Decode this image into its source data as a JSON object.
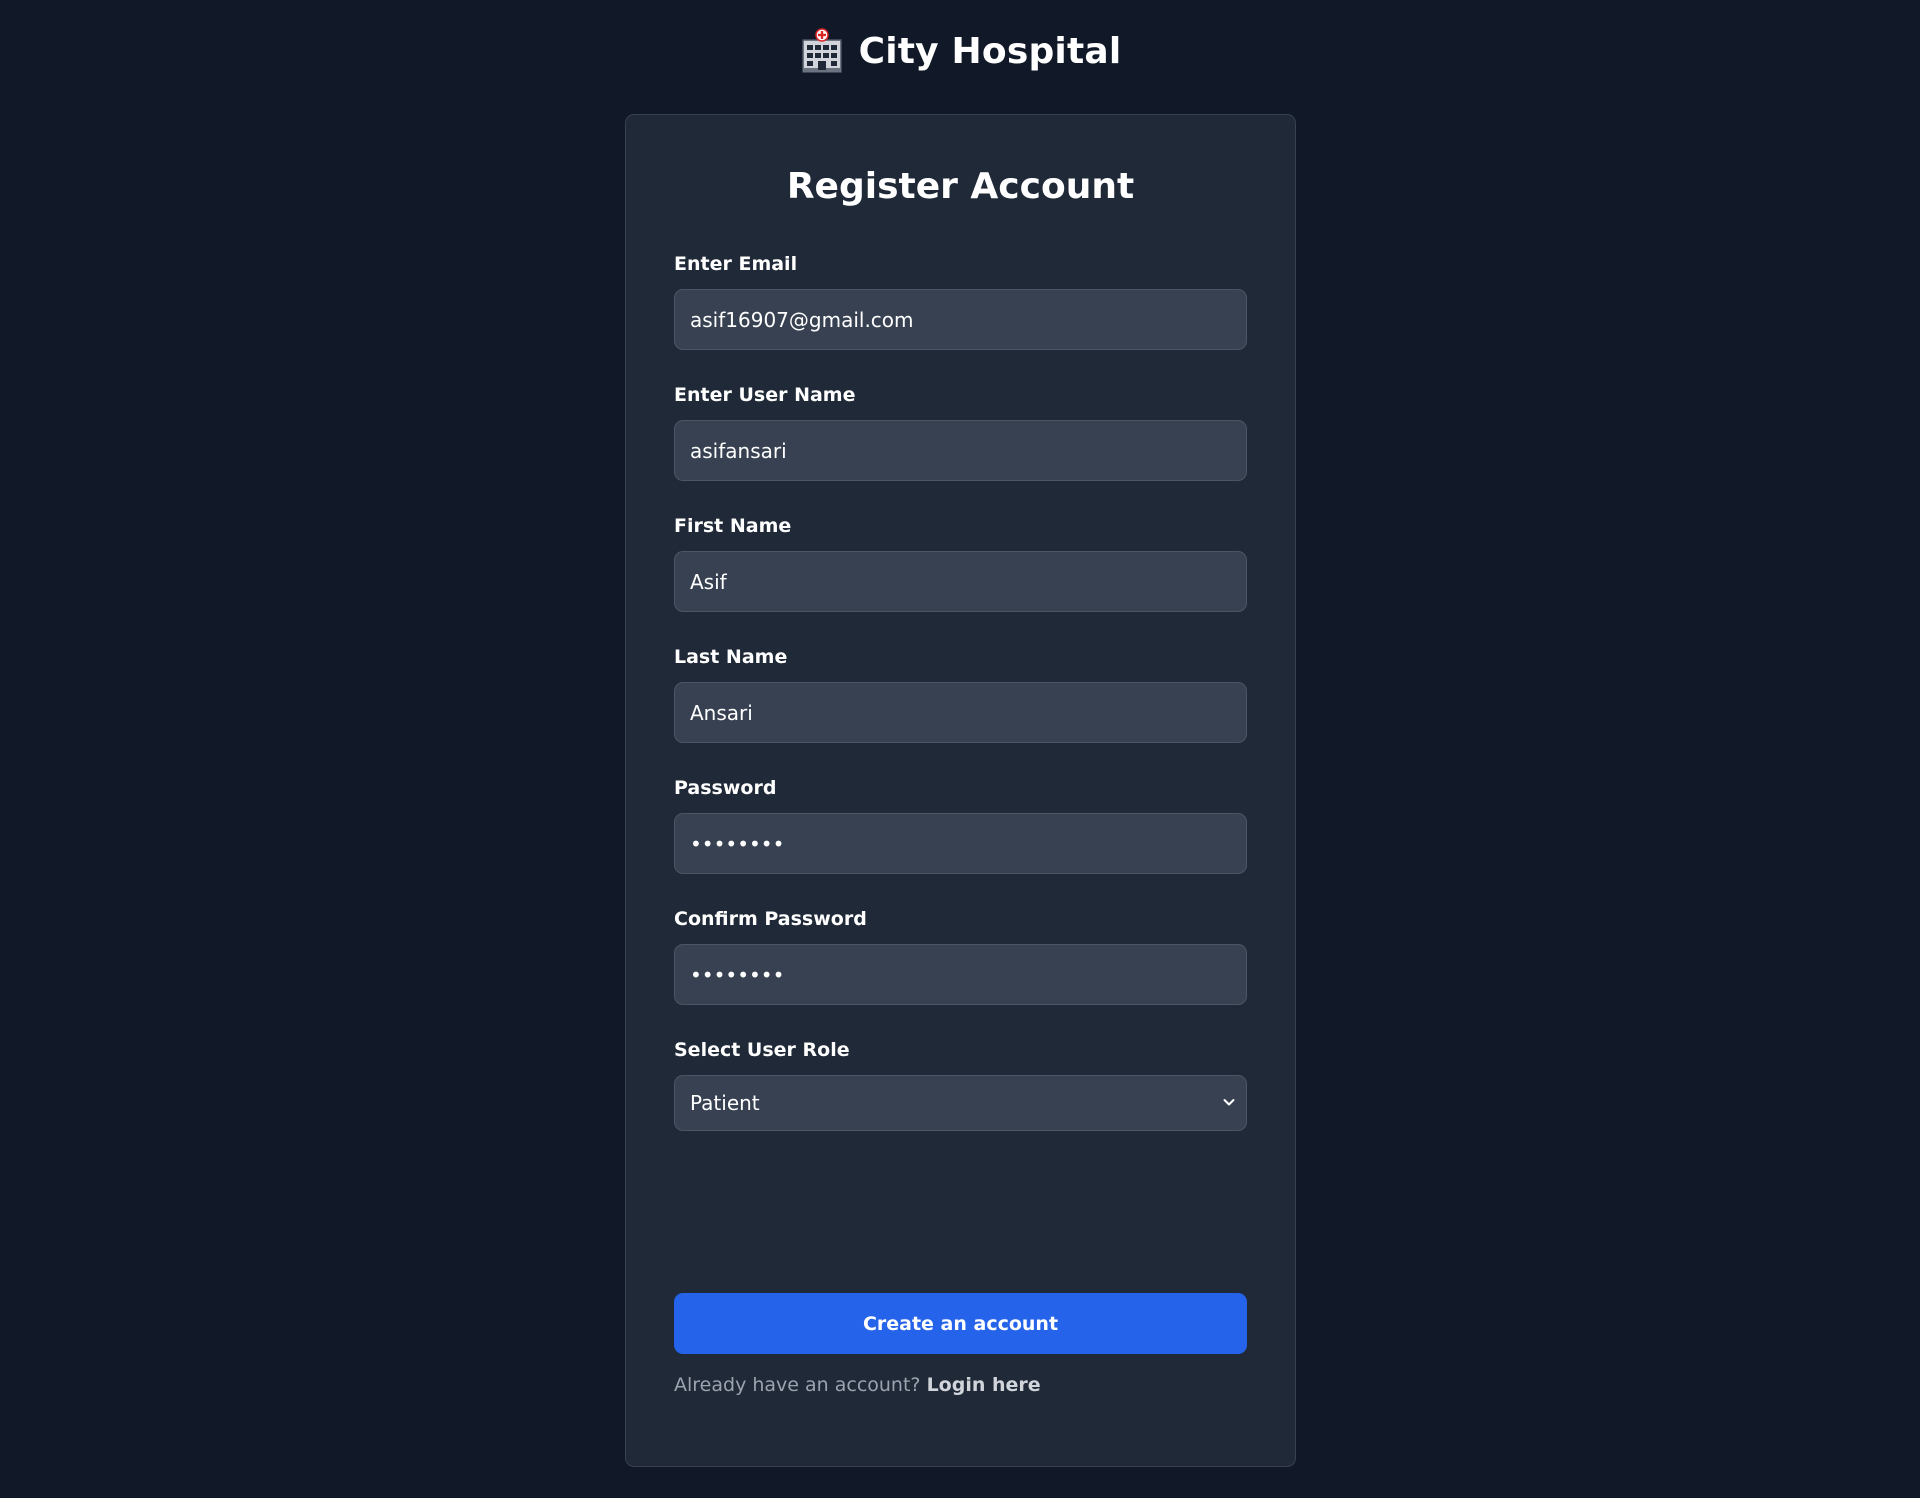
{
  "brand": {
    "icon": "hospital-icon",
    "name": "City Hospital"
  },
  "form": {
    "title": "Register Account",
    "email": {
      "label": "Enter Email",
      "value": "asif16907@gmail.com"
    },
    "username": {
      "label": "Enter User Name",
      "value": "asifansari"
    },
    "first_name": {
      "label": "First Name",
      "value": "Asif"
    },
    "last_name": {
      "label": "Last Name",
      "value": "Ansari"
    },
    "password": {
      "label": "Password",
      "value": "••••••••"
    },
    "confirm_password": {
      "label": "Confirm Password",
      "value": "••••••••"
    },
    "role": {
      "label": "Select User Role",
      "selected": "Patient",
      "icon": "chevron-down-icon"
    },
    "submit_label": "Create an account",
    "footer_prompt": "Already have an account?",
    "login_link": "Login here"
  },
  "colors": {
    "page_bg": "#111827",
    "card_bg": "#1f2937",
    "input_bg": "#374151",
    "accent": "#2563eb"
  }
}
